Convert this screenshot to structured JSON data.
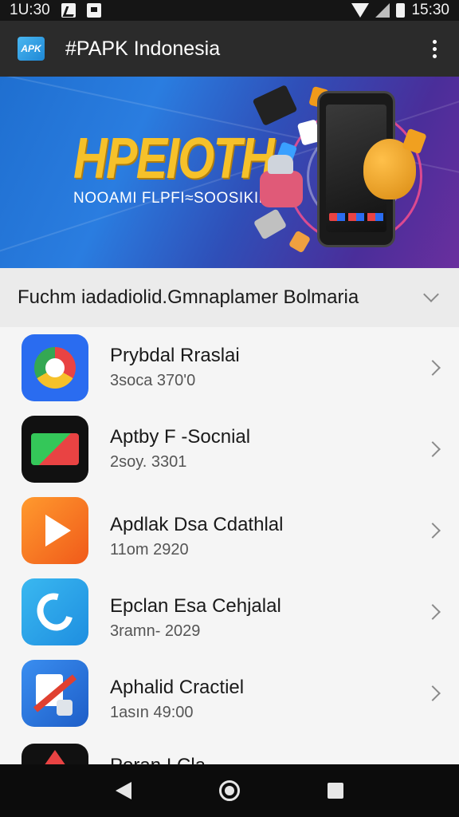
{
  "status_bar": {
    "time_left": "1U:30",
    "time_right": "15:30"
  },
  "app_bar": {
    "logo_text": "APK",
    "title": "#PAPK Indonesia"
  },
  "banner": {
    "title": "HPEIOTH",
    "subtitle": "NOOAMI FLPFI≈SOOSIKIL"
  },
  "section": {
    "title": "Fuchm iadadiolid.Gmnaplamer Bolmaria"
  },
  "apps": [
    {
      "name": "Prybdal Rraslai",
      "meta": "3soca 370'0",
      "icon": "chrome-like-app-icon"
    },
    {
      "name": "Aptby F -Socnial",
      "meta": "2soy. 3301",
      "icon": "chart-app-icon"
    },
    {
      "name": "Apdlak Dsa Cdathlal",
      "meta": "11om 2920",
      "icon": "play-app-icon"
    },
    {
      "name": "Epclan Esa Cehjalal",
      "meta": "3ramn- 2029",
      "icon": "lightning-app-icon"
    },
    {
      "name": "Aphalid Cractiel",
      "meta": "1asın 49:00",
      "icon": "lock-app-icon"
    },
    {
      "name": "Poran I Cla",
      "meta": "",
      "icon": "red-app-icon"
    }
  ],
  "colors": {
    "app_bar": "#2b2b2b",
    "accent": "#f6c12a",
    "banner_blue": "#2a7de0"
  }
}
